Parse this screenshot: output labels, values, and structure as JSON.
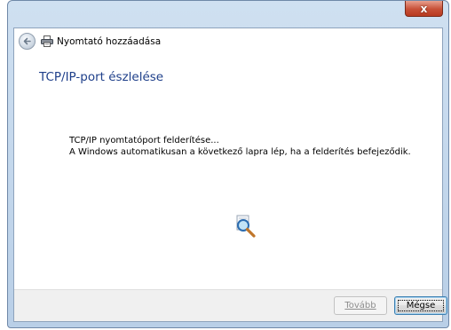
{
  "window": {
    "title": "Nyomtató hozzáadása",
    "close_glyph": "x"
  },
  "wizard": {
    "heading": "TCP/IP-port észlelése",
    "line1": "TCP/IP nyomtatóport felderítése...",
    "line2": "A Windows automatikusan a következő lapra lép, ha a felderítés befejeződik."
  },
  "buttons": {
    "next_label": "Tovább",
    "cancel_label": "Mégse"
  },
  "icons": {
    "back": "back-arrow-icon",
    "printer": "printer-icon",
    "search": "magnifier-search-icon",
    "close": "close-icon"
  },
  "colors": {
    "heading": "#1e3f8a",
    "footer": "#f0f0f0",
    "close": "#c75037"
  }
}
